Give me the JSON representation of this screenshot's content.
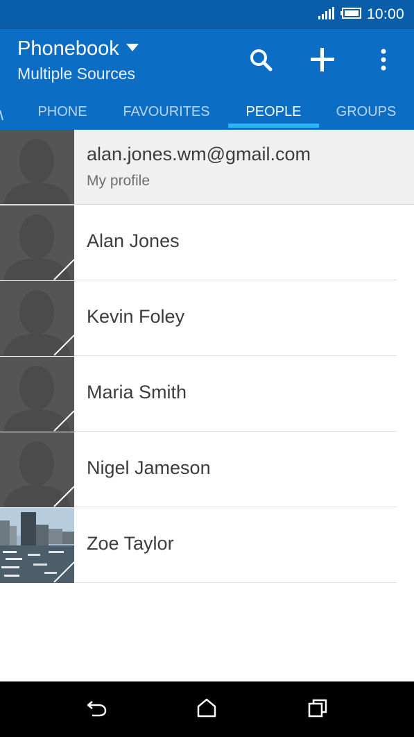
{
  "status": {
    "time": "10:00"
  },
  "header": {
    "title": "Phonebook",
    "subtitle": "Multiple Sources"
  },
  "tabs": [
    {
      "label": "PHONE"
    },
    {
      "label": "FAVOURITES"
    },
    {
      "label": "PEOPLE",
      "active": true
    },
    {
      "label": "GROUPS"
    }
  ],
  "profile": {
    "email": "alan.jones.wm@gmail.com",
    "label": "My profile"
  },
  "contacts": [
    {
      "name": "Alan Jones",
      "photo": "default-avatar"
    },
    {
      "name": "Kevin Foley",
      "photo": "default-avatar"
    },
    {
      "name": "Maria Smith",
      "photo": "default-avatar"
    },
    {
      "name": "Nigel Jameson",
      "photo": "default-avatar"
    },
    {
      "name": "Zoe Taylor",
      "photo": "harbor-photo"
    }
  ],
  "icons": {
    "search": "search-icon",
    "add": "plus-icon",
    "menu": "overflow-menu-icon",
    "back": "back-icon",
    "home": "home-icon",
    "recents": "recents-icon"
  },
  "colors": {
    "appbar": "#0b6dc4",
    "statusbar": "#0a5ea9",
    "indicator": "#29b6f6",
    "avatar": "#555555"
  }
}
